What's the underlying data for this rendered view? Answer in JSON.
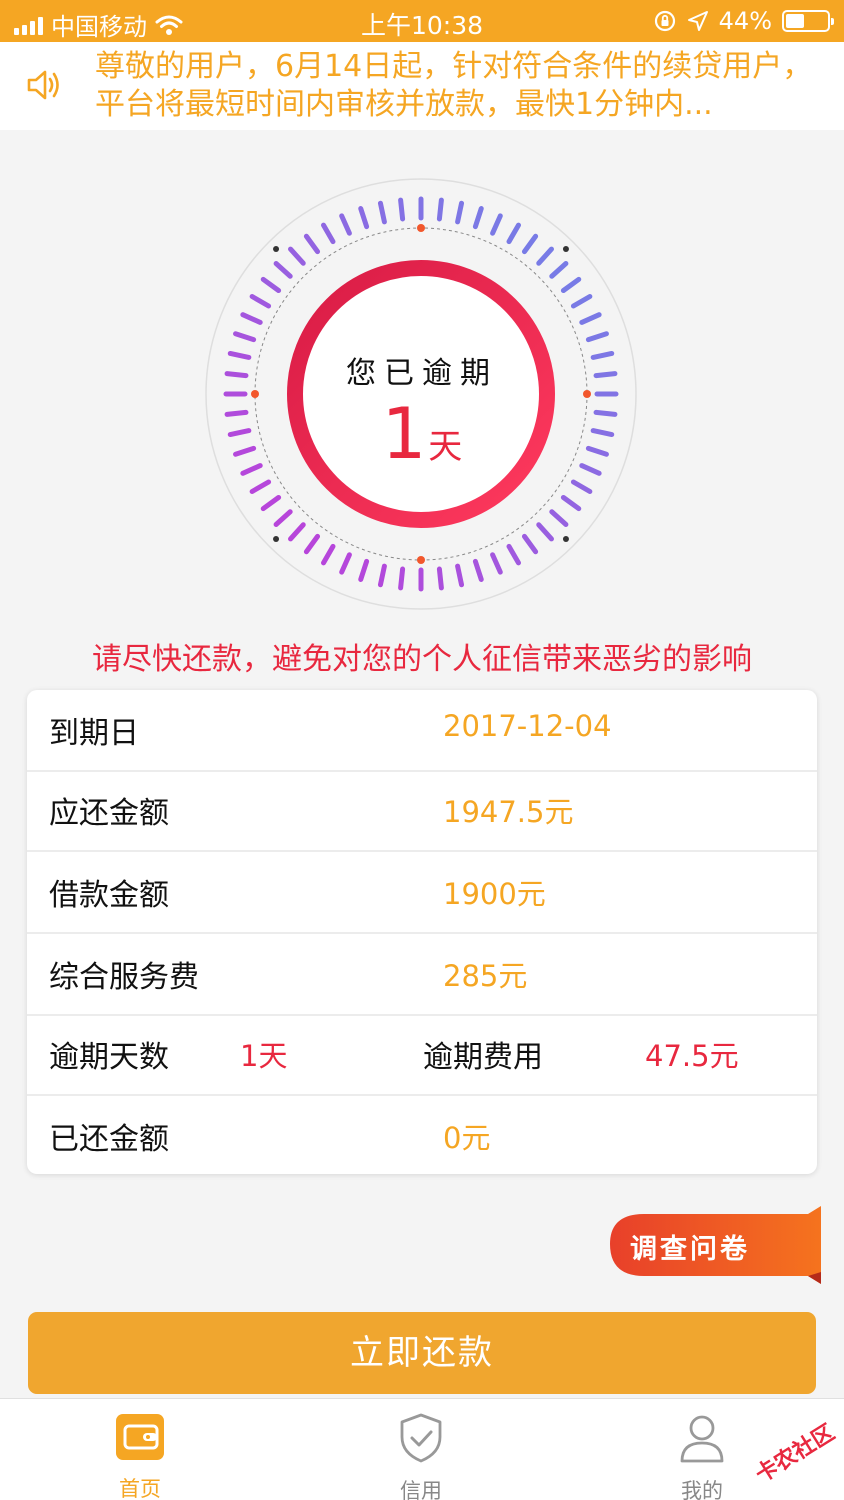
{
  "status_bar": {
    "carrier": "中国移动",
    "time": "上午10:38",
    "battery": "44%",
    "battery_level": 0.44
  },
  "notice": {
    "text": "尊敬的用户，6月14日起，针对符合条件的续贷用户，平台将最短时间内审核并放款，最快1分钟内..."
  },
  "overdue": {
    "title": "您已逾期",
    "days": "1",
    "unit": "天"
  },
  "warning": "请尽快还款，避免对您的个人征信带来恶劣的影响",
  "details": {
    "due_date": {
      "label": "到期日",
      "value": "2017-12-04"
    },
    "amount_due": {
      "label": "应还金额",
      "value": "1947.5元"
    },
    "loan_amount": {
      "label": "借款金额",
      "value": "1900元"
    },
    "service_fee": {
      "label": "综合服务费",
      "value": "285元"
    },
    "overdue_days": {
      "label": "逾期天数",
      "value": "1天"
    },
    "overdue_fee": {
      "label": "逾期费用",
      "value": "47.5元"
    },
    "repaid_amount": {
      "label": "已还金额",
      "value": "0元"
    }
  },
  "survey": {
    "label": "调查问卷"
  },
  "repay_button": {
    "label": "立即还款"
  },
  "tabs": [
    {
      "label": "首页",
      "icon": "wallet-icon",
      "active": true
    },
    {
      "label": "信用",
      "icon": "shield-check-icon",
      "active": false
    },
    {
      "label": "我的",
      "icon": "user-icon",
      "active": false
    }
  ],
  "watermark": {
    "text": "卡农社区"
  },
  "colors": {
    "accent": "#f5a623",
    "button": "#f0a62f",
    "alert": "#e8283f",
    "dial_start": "#c43ad8",
    "dial_end": "#6b86e8"
  }
}
